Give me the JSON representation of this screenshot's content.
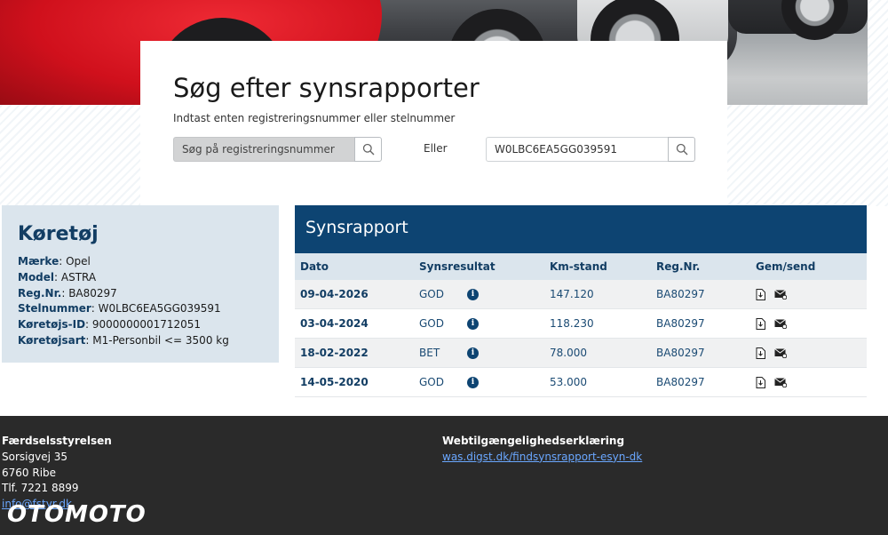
{
  "search": {
    "title": "Søg efter synsrapporter",
    "subtitle": "Indtast enten registreringsnummer eller stelnummer",
    "reg_placeholder": "Søg på registreringsnummer",
    "or_label": "Eller",
    "vin_value": "W0LBC6EA5GG039591"
  },
  "vehicle": {
    "heading": "Køretøj",
    "fields": [
      {
        "label": "Mærke",
        "value": "Opel"
      },
      {
        "label": "Model",
        "value": "ASTRA"
      },
      {
        "label": "Reg.Nr.",
        "value": "BA80297"
      },
      {
        "label": "Stelnummer",
        "value": "W0LBC6EA5GG039591"
      },
      {
        "label": "Køretøjs-ID",
        "value": "9000000001712051"
      },
      {
        "label": "Køretøjsart",
        "value": "M1-Personbil <= 3500 kg"
      }
    ]
  },
  "report": {
    "title": "Synsrapport",
    "columns": [
      "Dato",
      "Synsresultat",
      "Km-stand",
      "Reg.Nr.",
      "Gem/send"
    ],
    "rows": [
      {
        "date": "09-04-2026",
        "result": "GOD",
        "km": "147.120",
        "reg": "BA80297"
      },
      {
        "date": "03-04-2024",
        "result": "GOD",
        "km": "118.230",
        "reg": "BA80297"
      },
      {
        "date": "18-02-2022",
        "result": "BET",
        "km": "78.000",
        "reg": "BA80297"
      },
      {
        "date": "14-05-2020",
        "result": "GOD",
        "km": "53.000",
        "reg": "BA80297"
      }
    ],
    "info_glyph": "i"
  },
  "footer": {
    "org": "Færdselsstyrelsen",
    "street": "Sorsigvej 35",
    "city": "6760 Ribe",
    "phone": "Tlf. 7221 8899",
    "email": "info@fstyr.dk",
    "a11y_title": "Webtilgængelighedserklæring",
    "a11y_link": "was.digst.dk/findsynsrapport-esyn-dk"
  },
  "watermark": "OTOMOTO",
  "colors": {
    "primary": "#0d4472",
    "panel": "#dbe5ed",
    "footer": "#2a2a2a",
    "link": "#6aa7ff"
  }
}
